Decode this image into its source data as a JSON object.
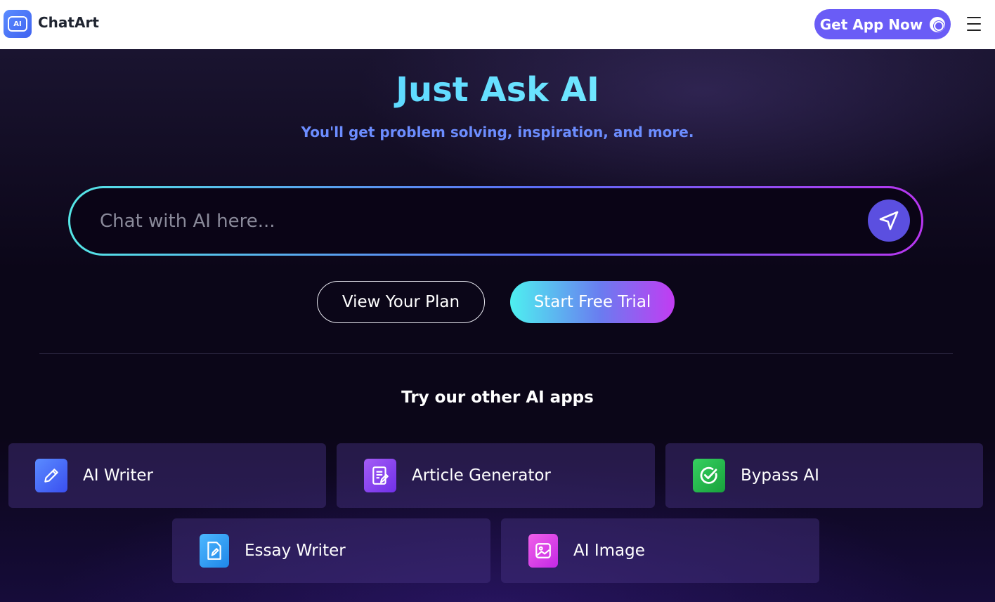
{
  "header": {
    "brand": "ChatArt",
    "logo_text": "AI",
    "get_app_label": "Get App Now"
  },
  "hero": {
    "title": "Just Ask AI",
    "subtitle": "You'll get problem solving, inspiration, and more.",
    "chat_placeholder": "Chat with AI here...",
    "view_plan_label": "View Your Plan",
    "start_trial_label": "Start Free Trial",
    "try_title": "Try our other AI apps"
  },
  "apps": [
    {
      "label": "AI Writer",
      "icon": "pencil-icon",
      "color": "#3e6cf5"
    },
    {
      "label": "Article Generator",
      "icon": "article-icon",
      "color": "#8a44f0"
    },
    {
      "label": "Bypass AI",
      "icon": "check-circle-icon",
      "color": "#22b84a"
    },
    {
      "label": "Essay Writer",
      "icon": "document-edit-icon",
      "color": "#2a9ef0"
    },
    {
      "label": "AI Image",
      "icon": "image-icon",
      "color": "#d83cf0"
    }
  ],
  "colors": {
    "accent": "#6a5cf6",
    "title_gradient_start": "#3fc1ff",
    "subtitle": "#6c8dff"
  }
}
